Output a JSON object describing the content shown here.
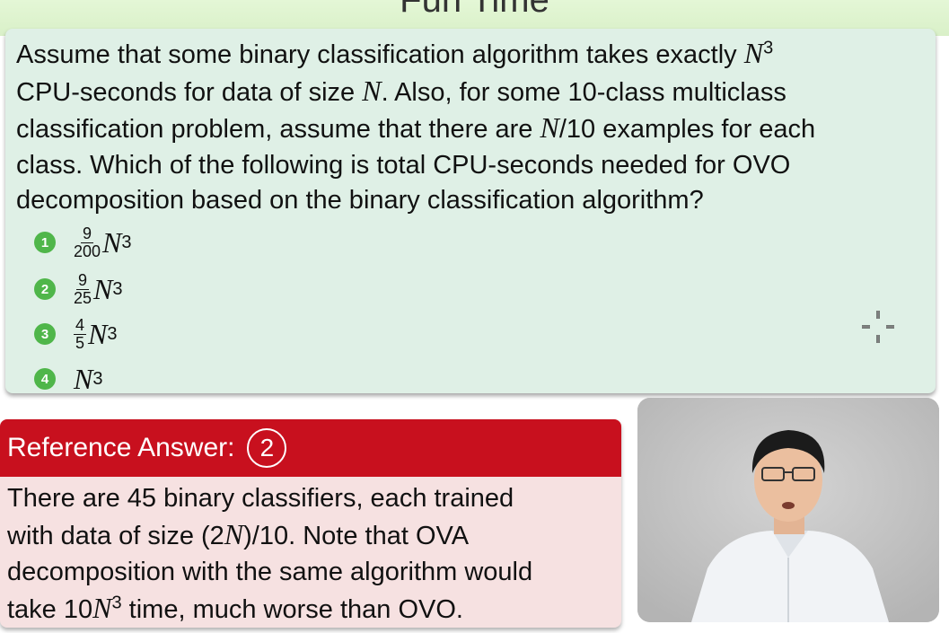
{
  "slide": {
    "title": "Fun Time"
  },
  "question": {
    "line1_pre": "Assume that some binary classification algorithm takes exactly ",
    "var_N": "N",
    "exp3": "3",
    "line2_pre": "CPU-seconds for data of size ",
    "line2_post": ". Also, for some 10-class multiclass",
    "line3_pre": "classification problem, assume that there are ",
    "line3_post": "/10 examples for each",
    "line4": "class. Which of the following is total CPU-seconds needed for OVO",
    "line5": "decomposition based on the binary classification algorithm?"
  },
  "options": [
    {
      "number": "1",
      "frac_num": "9",
      "frac_den": "200",
      "var": "N",
      "exp": "3"
    },
    {
      "number": "2",
      "frac_num": "9",
      "frac_den": "25",
      "var": "N",
      "exp": "3"
    },
    {
      "number": "3",
      "frac_num": "4",
      "frac_den": "5",
      "var": "N",
      "exp": "3"
    },
    {
      "number": "4",
      "var": "N",
      "exp": "3"
    }
  ],
  "answer": {
    "label": "Reference Answer:",
    "value": "2",
    "line1": "There are 45 binary classifiers, each trained",
    "line2_pre": "with data of size (2",
    "line2_post": ")/10. Note that OVA",
    "line3": "decomposition with the same algorithm would",
    "line4_pre": "take 10",
    "line4_post": " time, much worse than OVO.",
    "var_N": "N",
    "exp3": "3"
  },
  "colors": {
    "question_bg": "#dff0e6",
    "badge_green": "#4fb64a",
    "answer_header_red": "#c8101e",
    "answer_bg": "#f6e1e1",
    "top_band": "#e4f7d6"
  },
  "icons": {
    "cursor": "crosshair-cursor-icon"
  }
}
